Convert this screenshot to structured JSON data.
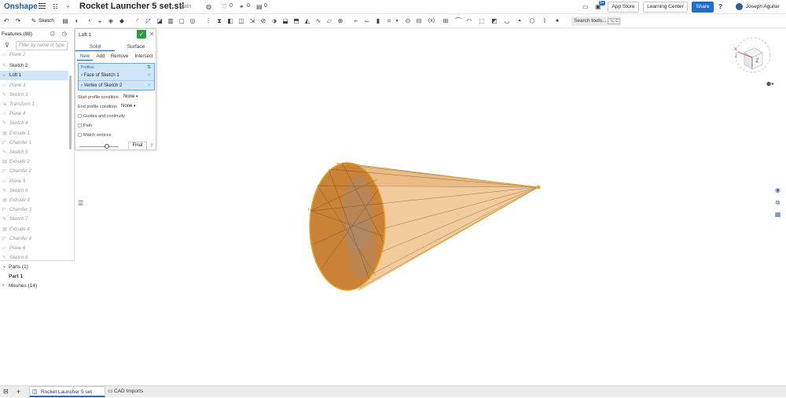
{
  "topbar": {
    "brand": "Onshape",
    "document_title": "Rocket Launcher 5 set.stl",
    "branch": "Main",
    "likes": "0",
    "links": "0",
    "versions": "0",
    "notifications": "9+",
    "app_store_label": "App Store",
    "learning_center_label": "Learning Center",
    "share_label": "Share",
    "help_label": "?",
    "user_name": "Joseph Aguilar"
  },
  "toolbar": {
    "sketch_label": "Sketch",
    "search_tools_label": "Search tools...",
    "search_shortcut": "⌥ C"
  },
  "features": {
    "header": "Features (88)",
    "filter_placeholder": "Filter by name or type",
    "items": [
      {
        "label": "Plane 2",
        "icon": "plane-icon"
      },
      {
        "label": "Sketch 2",
        "icon": "sketch-icon"
      },
      {
        "label": "Loft 1",
        "icon": "loft-icon"
      },
      {
        "label": "Plane 3",
        "icon": "plane-icon"
      },
      {
        "label": "Sketch 3",
        "icon": "sketch-icon"
      },
      {
        "label": "Transform 1",
        "icon": "transform-icon"
      },
      {
        "label": "Plane 4",
        "icon": "plane-icon"
      },
      {
        "label": "Sketch 4",
        "icon": "sketch-icon"
      },
      {
        "label": "Extrude 1",
        "icon": "extrude-icon"
      },
      {
        "label": "Chamfer 1",
        "icon": "chamfer-icon"
      },
      {
        "label": "Sketch 5",
        "icon": "sketch-icon"
      },
      {
        "label": "Extrude 2",
        "icon": "extrude-icon"
      },
      {
        "label": "Chamfer 2",
        "icon": "chamfer-icon"
      },
      {
        "label": "Plane 5",
        "icon": "plane-icon"
      },
      {
        "label": "Sketch 6",
        "icon": "sketch-icon"
      },
      {
        "label": "Extrude 3",
        "icon": "extrude-icon"
      },
      {
        "label": "Chamfer 3",
        "icon": "chamfer-icon"
      },
      {
        "label": "Sketch 7",
        "icon": "sketch-icon"
      },
      {
        "label": "Extrude 4",
        "icon": "extrude-icon"
      },
      {
        "label": "Chamfer 4",
        "icon": "chamfer-icon"
      },
      {
        "label": "Plane 6",
        "icon": "plane-icon"
      },
      {
        "label": "Sketch 8",
        "icon": "sketch-icon"
      }
    ]
  },
  "parts": {
    "parts_header": "Parts (1)",
    "part_1": "Part 1",
    "meshes_header": "Meshes (14)"
  },
  "loft": {
    "title": "Loft 1",
    "tab_solid": "Solid",
    "tab_surface": "Surface",
    "op_new": "New",
    "op_add": "Add",
    "op_remove": "Remove",
    "op_intersect": "Intersect",
    "profiles_label": "Profiles",
    "profile_1": "Face of Sketch 1",
    "profile_2": "Vertex of Sketch 2",
    "start_condition_label": "Start profile condition",
    "start_condition_value": "None",
    "end_condition_label": "End profile condition",
    "end_condition_value": "None",
    "guides_label": "Guides and continuity",
    "path_label": "Path",
    "match_vertices_label": "Match vertices",
    "final_label": "Final"
  },
  "viewcube": {
    "face_label": "Top",
    "axis_x": "X",
    "axis_z": "Z"
  },
  "bottom_tabs": {
    "tab_1": "Rocket Launcher 5 set",
    "tab_2": "CAD Imports"
  },
  "colors": {
    "accent": "#1f6fc8",
    "cone_fill": "#e0a263",
    "cone_face": "#c98236",
    "cone_edge": "#e8a524",
    "selection": "#cfe6f9",
    "ok_green": "#2a9d3c"
  }
}
